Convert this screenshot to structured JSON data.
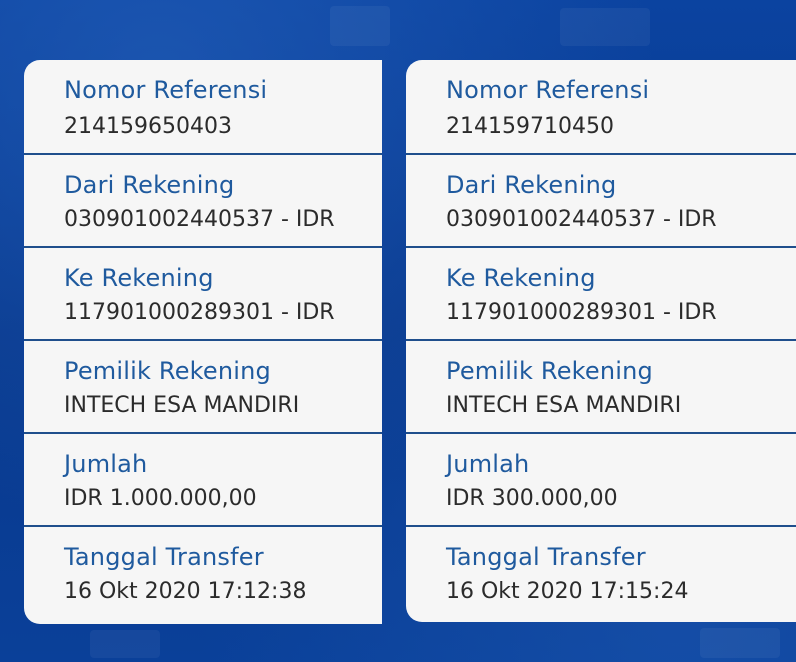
{
  "receipts": [
    {
      "fields": [
        {
          "label": "Nomor Referensi",
          "value": "214159650403"
        },
        {
          "label": "Dari Rekening",
          "value": "030901002440537 - IDR"
        },
        {
          "label": "Ke Rekening",
          "value": "117901000289301 - IDR"
        },
        {
          "label": "Pemilik Rekening",
          "value": "INTECH ESA MANDIRI"
        },
        {
          "label": "Jumlah",
          "value": "IDR 1.000.000,00"
        },
        {
          "label": "Tanggal Transfer",
          "value": "16 Okt 2020 17:12:38"
        }
      ]
    },
    {
      "fields": [
        {
          "label": "Nomor Referensi",
          "value": "214159710450"
        },
        {
          "label": "Dari Rekening",
          "value": "030901002440537 - IDR"
        },
        {
          "label": "Ke Rekening",
          "value": "117901000289301 - IDR"
        },
        {
          "label": "Pemilik Rekening",
          "value": "INTECH ESA MANDIRI"
        },
        {
          "label": "Jumlah",
          "value": "IDR 300.000,00"
        },
        {
          "label": "Tanggal Transfer",
          "value": "16 Okt 2020 17:15:24"
        }
      ]
    }
  ]
}
